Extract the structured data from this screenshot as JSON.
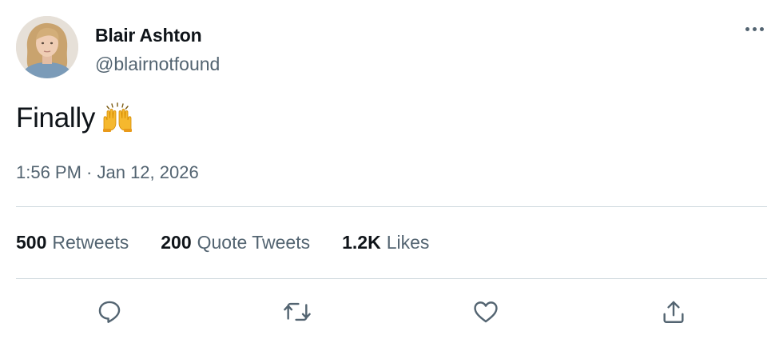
{
  "author": {
    "display_name": "Blair Ashton",
    "handle": "@blairnotfound",
    "avatar_icon": "user-avatar-photo"
  },
  "more_icon": "ellipsis-icon",
  "tweet": {
    "text": "Finally",
    "emoji": "raising-hands-emoji",
    "timestamp": "1:56 PM · Jan 12, 2026"
  },
  "stats": {
    "retweets": {
      "count": "500",
      "label": "Retweets"
    },
    "quote_tweets": {
      "count": "200",
      "label": "Quote Tweets"
    },
    "likes": {
      "count": "1.2K",
      "label": "Likes"
    }
  },
  "actions": [
    {
      "name": "reply",
      "icon": "reply-icon"
    },
    {
      "name": "retweet",
      "icon": "retweet-icon"
    },
    {
      "name": "like",
      "icon": "heart-icon"
    },
    {
      "name": "share",
      "icon": "share-icon"
    }
  ],
  "colors": {
    "text_primary": "#0f1419",
    "text_secondary": "#536471",
    "divider": "#cfd9de",
    "icon": "#536471"
  }
}
